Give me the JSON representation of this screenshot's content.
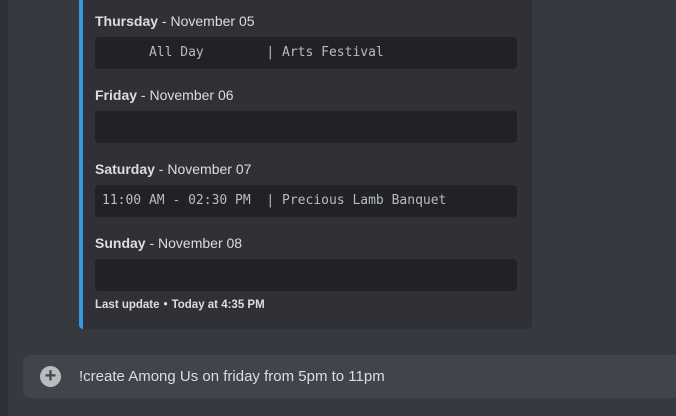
{
  "embed": {
    "accent_color": "#3498db",
    "days": [
      {
        "day": "Thursday",
        "separator": " - ",
        "date": "November 05",
        "event": "      All Day        | Arts Festival"
      },
      {
        "day": "Friday",
        "separator": " - ",
        "date": "November 06",
        "event": ""
      },
      {
        "day": "Saturday",
        "separator": " - ",
        "date": "November 07",
        "event": "11:00 AM - 02:30 PM  | Precious Lamb Banquet"
      },
      {
        "day": "Sunday",
        "separator": " - ",
        "date": "November 08",
        "event": ""
      }
    ],
    "footer": {
      "label": "Last update",
      "bullet": "•",
      "time": "Today at 4:35 PM"
    }
  },
  "chat_input": {
    "plus_icon": "plus-circle-icon",
    "value": "!create Among Us on friday from 5pm to 11pm"
  }
}
